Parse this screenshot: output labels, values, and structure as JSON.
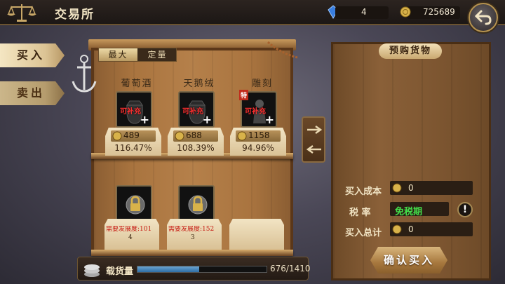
{
  "header": {
    "title": "交易所",
    "gems": "4",
    "coins": "725689"
  },
  "side_tabs": {
    "buy": "买入",
    "sell": "卖出"
  },
  "filter_tabs": [
    "最大",
    "定量"
  ],
  "shelf_items": [
    {
      "name": "葡萄酒",
      "status": "可补充",
      "price": "489",
      "percent": "116.47%",
      "special": ""
    },
    {
      "name": "天鹅绒",
      "status": "可补充",
      "price": "688",
      "percent": "108.39%",
      "special": ""
    },
    {
      "name": "雕刻",
      "status": "可补充",
      "price": "1158",
      "percent": "94.96%",
      "special": "特"
    }
  ],
  "locked_items": [
    {
      "requirement": "需要发展度:101",
      "line2": "4"
    },
    {
      "requirement": "需要发展度:152",
      "line2": "3"
    }
  ],
  "cargo": {
    "label": "载货量",
    "value": "676/1410",
    "fraction": 0.479
  },
  "order_panel": {
    "title": "预购货物",
    "cost_label": "买入成本",
    "cost_value": "0",
    "tax_label": "税    率",
    "tax_value": "免税期",
    "total_label": "买入总计",
    "total_value": "0",
    "confirm": "确认买入"
  },
  "colors": {
    "accent": "#b5924f",
    "tax_green": "#44e04a",
    "refill_red": "#ff3030",
    "cargo_blue": "#2e6ea6"
  }
}
